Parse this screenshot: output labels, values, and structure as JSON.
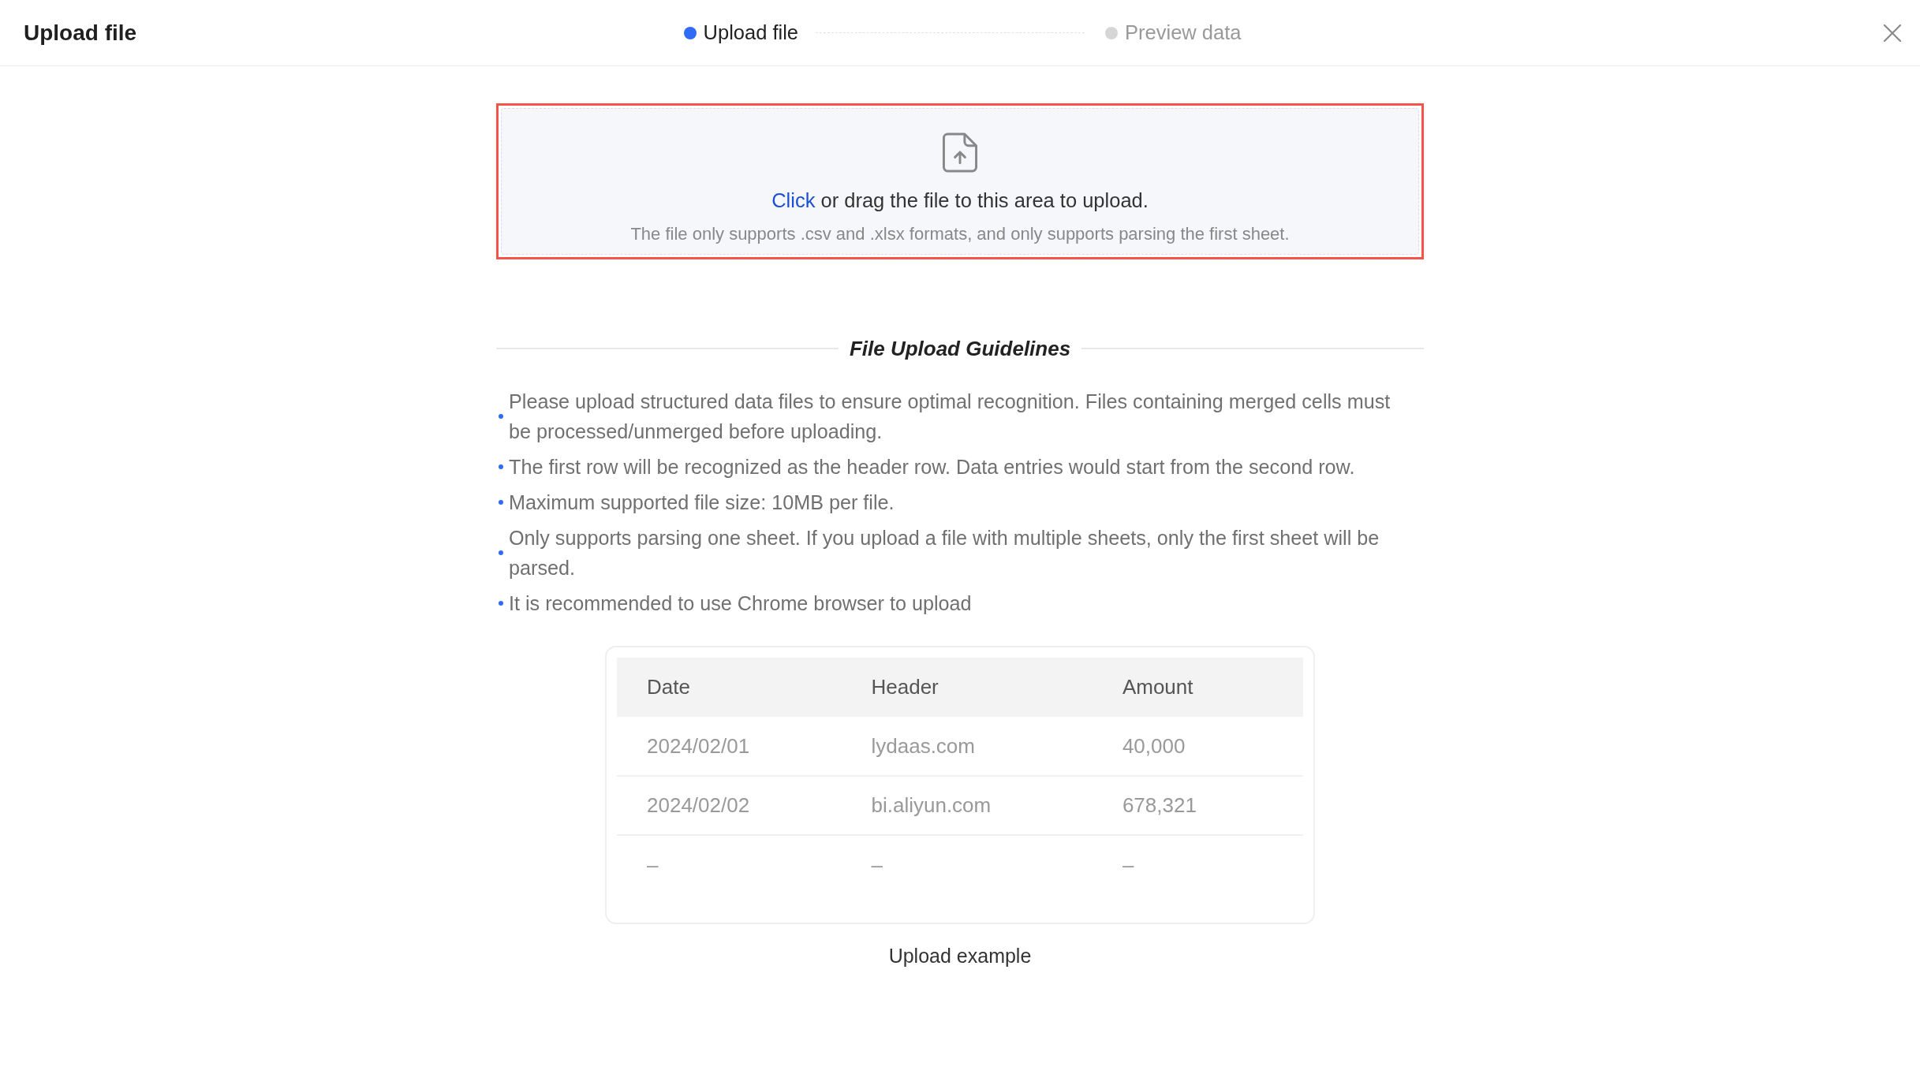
{
  "dialog": {
    "title": "Upload file"
  },
  "steps": [
    {
      "label": "Upload file",
      "selected": true
    },
    {
      "label": "Preview data",
      "selected": false
    }
  ],
  "upload_area": {
    "highlighted": true,
    "link": "Click",
    "prompt": "or drag the file to this area to upload.",
    "hint": "The file only supports .csv and .xlsx formats, and only supports parsing the first sheet."
  },
  "guidelines": {
    "title": "File Upload Guidelines",
    "items": [
      "Please upload structured data files to ensure optimal recognition. Files containing merged cells must be processed/unmerged before uploading.",
      "The first row will be recognized as the header row. Data entries would start from the second row.",
      "Maximum supported file size: 10MB per file.",
      "Only supports parsing one sheet. If you upload a file with multiple sheets, only the first sheet will be parsed.",
      "It is recommended to use Chrome browser to upload"
    ]
  },
  "example": {
    "columns": [
      "Date",
      "Header",
      "Amount"
    ],
    "rows": [
      [
        "2024/02/01",
        "lydaas.com",
        "40,000"
      ],
      [
        "2024/02/02",
        "bi.aliyun.com",
        "678,321"
      ],
      [
        "–",
        "–",
        "–"
      ]
    ],
    "caption": "Upload example"
  }
}
